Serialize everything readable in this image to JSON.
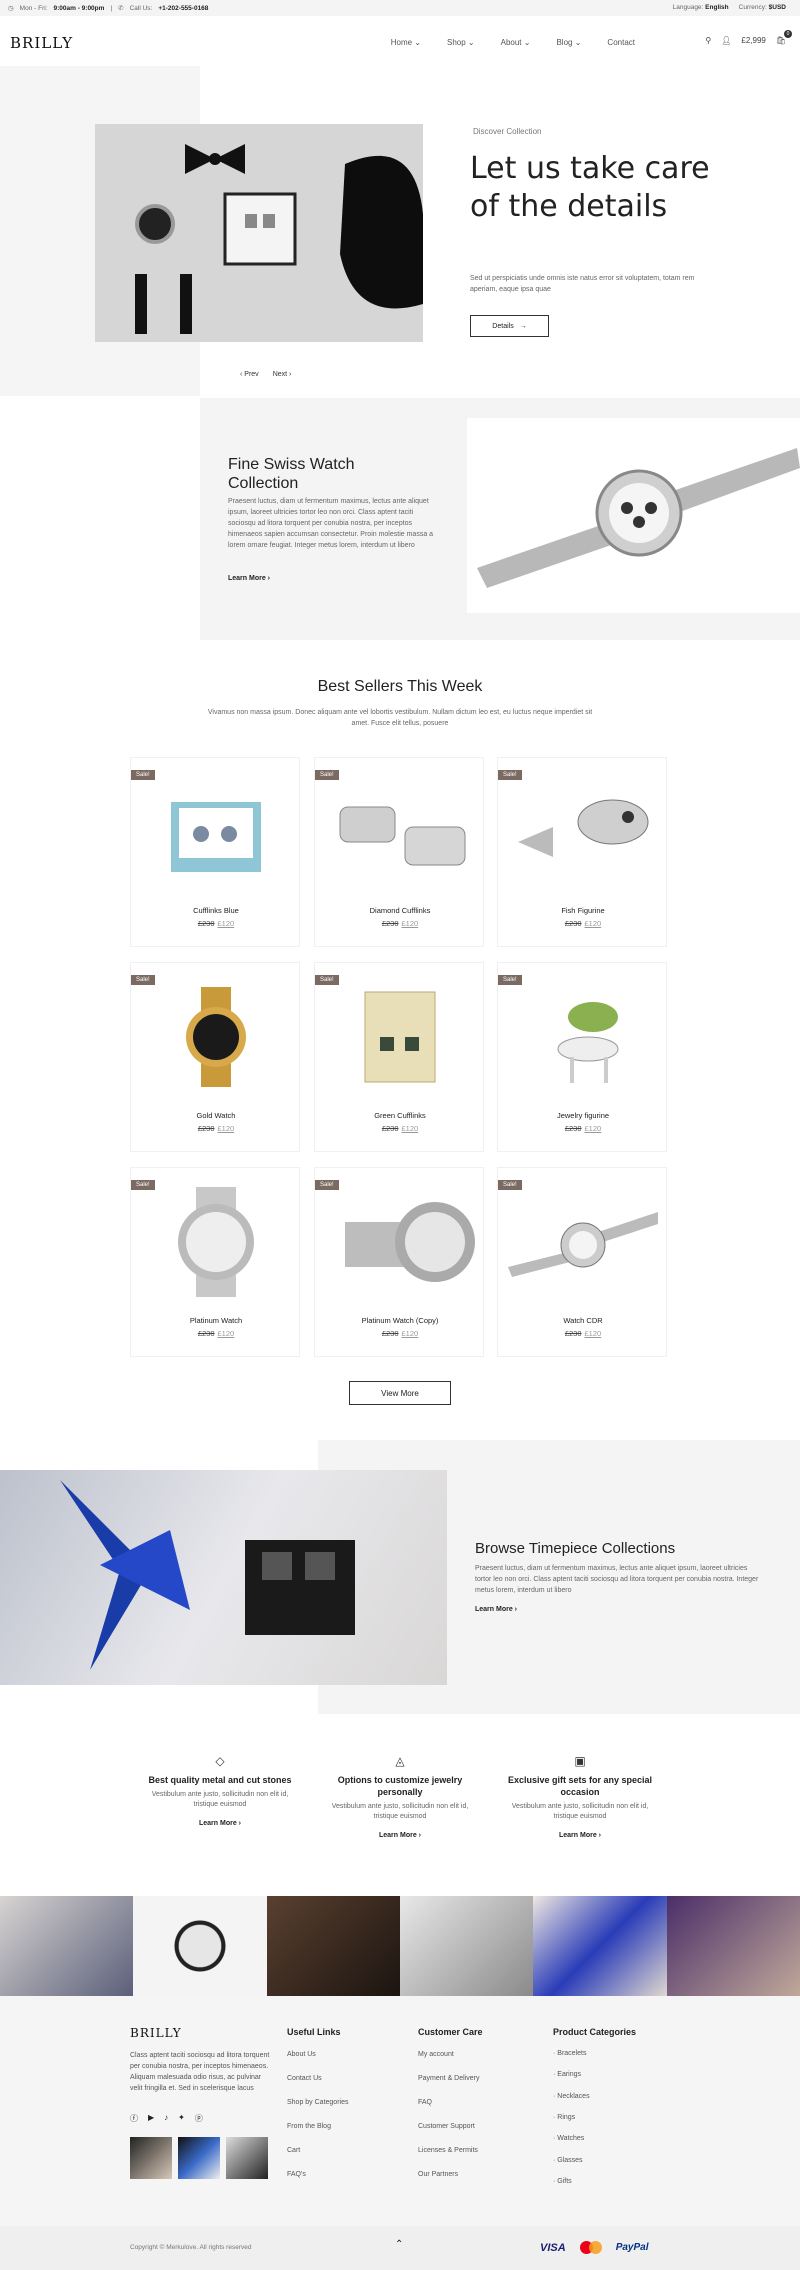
{
  "topbar": {
    "hours_prefix": "Mon - Fri:",
    "hours": "9:00am - 9:00pm",
    "call_prefix": "Call Us:",
    "phone": "+1-202-555-0168",
    "language_label": "Language:",
    "language": "English",
    "currency_label": "Currency:",
    "currency": "$USD"
  },
  "header": {
    "logo": "BRILLY",
    "nav": [
      "Home",
      "Shop",
      "About",
      "Blog",
      "Contact"
    ],
    "cart_total": "£2,999",
    "cart_count": "0"
  },
  "hero": {
    "subtitle": "Discover Collection",
    "title": "Let us take care of the details",
    "text": "Sed ut perspiciatis unde omnis iste natus error sit voluptatem, totam rem aperiam, eaque ipsa quae",
    "button": "Details",
    "prev": "Prev",
    "next": "Next"
  },
  "swiss": {
    "title": "Fine Swiss Watch Collection",
    "text": "Praesent luctus, diam ut fermentum maximus, lectus ante aliquet ipsum, laoreet ultricies tortor leo non orci. Class aptent taciti sociosqu ad litora torquent per conubia nostra, per inceptos himenaeos sapien accumsan consectetur. Proin molestie massa a lorem ornare feugiat. Integer metus lorem, interdum ut libero",
    "link": "Learn More"
  },
  "bestsellers": {
    "title": "Best Sellers This Week",
    "text": "Vivamus non massa ipsum. Donec aliquam ante vel lobortis vestibulum. Nullam dictum leo est, eu luctus neque imperdiet sit amet. Fusce elit tellus, posuere",
    "sale_badge": "Sale!",
    "old_price": "£230",
    "new_price": "£120",
    "products": [
      "Cufflinks Blue",
      "Diamond Cufflinks",
      "Fish Figurine",
      "Gold Watch",
      "Green Cufflinks",
      "Jewelry figurine",
      "Platinum Watch",
      "Platinum Watch (Copy)",
      "Watch CDR"
    ],
    "view_more": "View More"
  },
  "browse": {
    "title": "Browse Timepiece Collections",
    "text": "Praesent luctus, diam ut fermentum maximus, lectus ante aliquet ipsum, laoreet ultricies tortor leo non orci. Class aptent taciti sociosqu ad litora torquent per conubia nostra. Integer metus lorem, interdum ut libero",
    "link": "Learn More"
  },
  "features": [
    {
      "icon": "diamond-icon",
      "title": "Best quality metal and cut stones",
      "text": "Vestibulum ante justo, sollicitudin non elit id, tristique euismod",
      "link": "Learn More"
    },
    {
      "icon": "ring-icon",
      "title": "Options to customize jewelry personally",
      "text": "Vestibulum ante justo, sollicitudin non elit id, tristique euismod",
      "link": "Learn More"
    },
    {
      "icon": "gift-icon",
      "title": "Exclusive gift sets for any special occasion",
      "text": "Vestibulum ante justo, sollicitudin non elit id, tristique euismod",
      "link": "Learn More"
    }
  ],
  "footer": {
    "logo": "BRILLY",
    "about": "Class aptent taciti sociosqu ad litora torquent per conubia nostra, per inceptos himenaeos. Aliquam malesuada odio risus, ac pulvinar velit fringilla et. Sed in scelerisque lacus",
    "useful_title": "Useful Links",
    "useful_links": [
      "About Us",
      "Contact Us",
      "Shop by Categories",
      "From the Blog",
      "Cart",
      "FAQ's"
    ],
    "care_title": "Customer Care",
    "care_links": [
      "My account",
      "Payment & Delivery",
      "FAQ",
      "Customer Support",
      "Licenses & Permits",
      "Our Partners"
    ],
    "cat_title": "Product Categories",
    "categories": [
      "Bracelets",
      "Earings",
      "Necklaces",
      "Rings",
      "Watches",
      "Glasses",
      "Gifts"
    ],
    "copyright": "Copyright © Merkulove. All rights reserved",
    "payments": [
      "VISA",
      "PayPal"
    ]
  }
}
